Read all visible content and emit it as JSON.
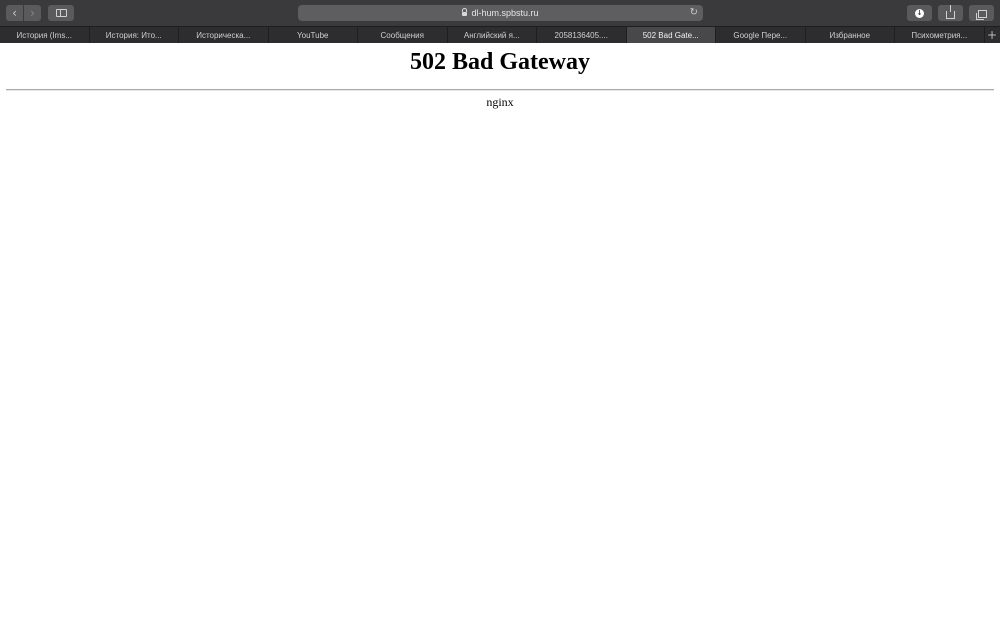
{
  "toolbar": {
    "back_icon": "chevron-left-icon",
    "forward_icon": "chevron-right-icon",
    "sidebar_icon": "sidebar-icon",
    "url": "dl-hum.spbstu.ru",
    "reload_icon": "reload-icon",
    "download_icon": "download-icon",
    "share_icon": "share-icon",
    "tabs_icon": "tabs-overview-icon"
  },
  "tabs": [
    {
      "label": "История (Ims..."
    },
    {
      "label": "История: Ито..."
    },
    {
      "label": "Историческа..."
    },
    {
      "label": "YouTube"
    },
    {
      "label": "Сообщения"
    },
    {
      "label": "Английский я..."
    },
    {
      "label": "2058136405...."
    },
    {
      "label": "502 Bad Gate...",
      "active": true
    },
    {
      "label": "Google Пере..."
    },
    {
      "label": "Избранное"
    },
    {
      "label": "Психометрия..."
    }
  ],
  "page": {
    "title": "502 Bad Gateway",
    "server": "nginx"
  },
  "colors": {
    "toolbar_bg": "#3a3a3c",
    "tabbar_bg": "#2d2d2f",
    "active_tab_bg": "#48484b",
    "page_bg": "#ffffff"
  }
}
